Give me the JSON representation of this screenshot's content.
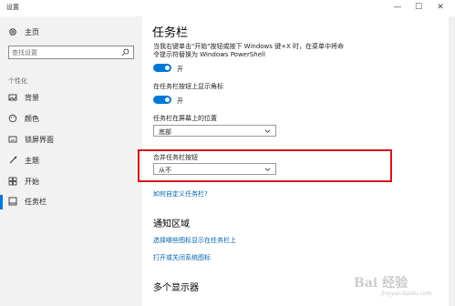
{
  "window": {
    "title": "设置",
    "minimize_glyph": "—",
    "maximize_glyph": "☐",
    "close_glyph": "✕"
  },
  "sidebar": {
    "home_label": "主页",
    "search_placeholder": "查找设置",
    "section_label": "个性化",
    "items": [
      {
        "label": "背景",
        "icon": "image-icon"
      },
      {
        "label": "颜色",
        "icon": "palette-icon"
      },
      {
        "label": "锁屏界面",
        "icon": "lockscreen-icon"
      },
      {
        "label": "主题",
        "icon": "brush-icon"
      },
      {
        "label": "开始",
        "icon": "start-icon"
      },
      {
        "label": "任务栏",
        "icon": "taskbar-icon",
        "active": true
      }
    ]
  },
  "main": {
    "title": "任务栏",
    "powershell_desc": "当我右键单击\"开始\"按钮或按下 Windows 键+X 时，在菜单中将命令提示符替换为 Windows PowerShell",
    "powershell_toggle": "开",
    "badges_label": "在任务栏按钮上显示角标",
    "badges_toggle": "开",
    "position_label": "任务栏在屏幕上的位置",
    "position_value": "底部",
    "combine_label": "合并任务栏按钮",
    "combine_value": "从不",
    "customize_link": "如何自定义任务栏?",
    "notification_heading": "通知区域",
    "notif_link1": "选择哪些图标显示在任务栏上",
    "notif_link2": "打开或关闭系统图标",
    "multi_display_heading": "多个显示器"
  },
  "watermark": {
    "text": "Bai 经验",
    "sub": "jingyan.baidu.com"
  },
  "colors": {
    "accent": "#0078d7",
    "highlight_border": "#d4141a",
    "link": "#0063b1"
  }
}
